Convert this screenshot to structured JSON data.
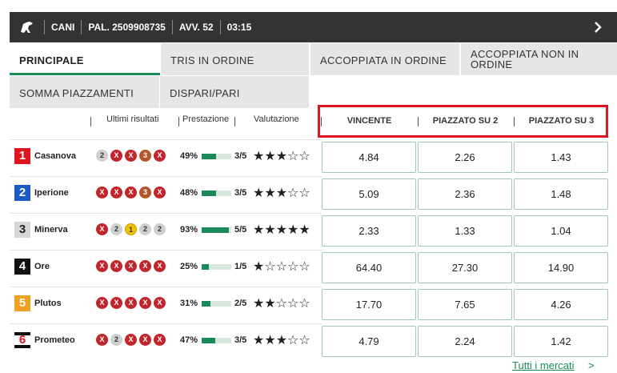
{
  "header": {
    "category": "CANI",
    "pal": "PAL. 2509908735",
    "avv": "AVV. 52",
    "time": "03:15"
  },
  "tabs": [
    "PRINCIPALE",
    "TRIS IN ORDINE",
    "ACCOPPIATA IN ORDINE",
    "ACCOPPIATA NON IN ORDINE",
    "SOMMA PIAZZAMENTI",
    "DISPARI/PARI"
  ],
  "columns": {
    "results": "Ultimi risultati",
    "performance": "Prestazione",
    "rating": "Valutazione",
    "odds": [
      "VINCENTE",
      "PIAZZATO SU 2",
      "PIAZZATO SU 3"
    ]
  },
  "runners": [
    {
      "num": "1",
      "name": "Casanova",
      "color": "#e0141e",
      "results": [
        "2",
        "X",
        "X",
        "3",
        "X"
      ],
      "pct": "49%",
      "pct_value": 0.49,
      "rating": "3/5",
      "stars": 3,
      "odds": [
        "4.84",
        "2.26",
        "1.43"
      ]
    },
    {
      "num": "2",
      "name": "Iperione",
      "color": "#1a5bc4",
      "results": [
        "X",
        "X",
        "X",
        "3",
        "X"
      ],
      "pct": "48%",
      "pct_value": 0.48,
      "rating": "3/5",
      "stars": 3,
      "odds": [
        "5.09",
        "2.36",
        "1.48"
      ]
    },
    {
      "num": "3",
      "name": "Minerva",
      "color": "#d6d6d6",
      "results": [
        "X",
        "2",
        "1",
        "2",
        "2"
      ],
      "pct": "93%",
      "pct_value": 0.93,
      "rating": "5/5",
      "stars": 5,
      "odds": [
        "2.33",
        "1.33",
        "1.04"
      ]
    },
    {
      "num": "4",
      "name": "Ore",
      "color": "#111111",
      "results": [
        "X",
        "X",
        "X",
        "X",
        "X"
      ],
      "pct": "25%",
      "pct_value": 0.25,
      "rating": "1/5",
      "stars": 1,
      "odds": [
        "64.40",
        "27.30",
        "14.90"
      ]
    },
    {
      "num": "5",
      "name": "Plutos",
      "color": "#f0a020",
      "results": [
        "X",
        "X",
        "X",
        "X",
        "X"
      ],
      "pct": "31%",
      "pct_value": 0.31,
      "rating": "2/5",
      "stars": 2,
      "odds": [
        "17.70",
        "7.65",
        "4.26"
      ]
    },
    {
      "num": "6",
      "name": "Prometeo",
      "color": "#222222",
      "results": [
        "X",
        "2",
        "X",
        "X",
        "X"
      ],
      "pct": "47%",
      "pct_value": 0.47,
      "rating": "3/5",
      "stars": 3,
      "odds": [
        "4.79",
        "2.24",
        "1.42"
      ]
    }
  ],
  "result_colors": {
    "X": "#c0262c",
    "1": "#f2c200",
    "2": "#cfcfcf",
    "3": "#b5562a"
  },
  "footer": {
    "link": "Tutti i mercati",
    "chevron": ">"
  }
}
